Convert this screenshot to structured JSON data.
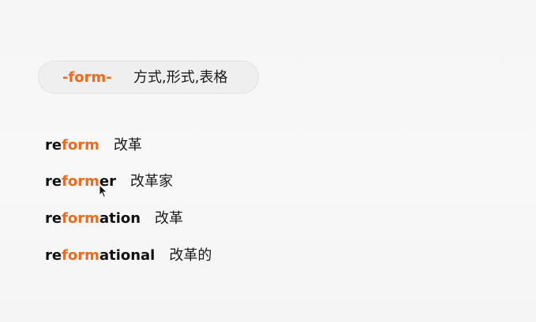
{
  "root": {
    "morpheme": "-form-",
    "meaning": "方式,形式,表格"
  },
  "words": [
    {
      "prefix": "re",
      "root": "form",
      "suffix": "",
      "meaning": "改革"
    },
    {
      "prefix": "re",
      "root": "form",
      "suffix": "er",
      "meaning": "改革家"
    },
    {
      "prefix": "re",
      "root": "form",
      "suffix": "ation",
      "meaning": "改革"
    },
    {
      "prefix": "re",
      "root": "form",
      "suffix": "ational",
      "meaning": "改革的"
    }
  ],
  "colors": {
    "highlight": "#ee6a1c",
    "text": "#111111",
    "background": "#f7f7f7"
  },
  "icons": {
    "cursor": "mouse-pointer-icon"
  }
}
